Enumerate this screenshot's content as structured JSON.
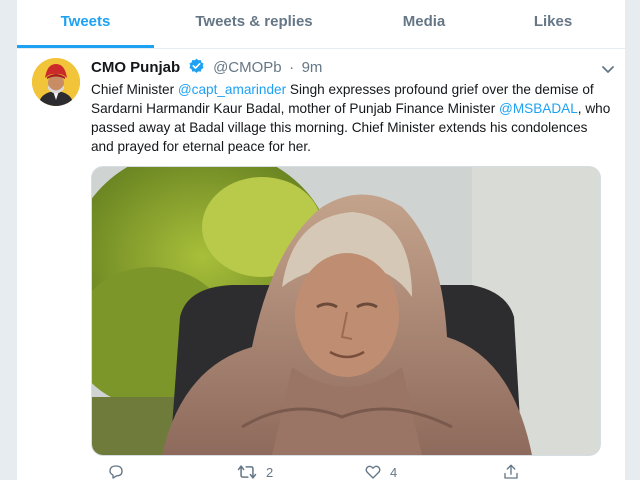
{
  "tabs": [
    {
      "label": "Tweets",
      "active": true
    },
    {
      "label": "Tweets & replies",
      "active": false
    },
    {
      "label": "Media",
      "active": false
    },
    {
      "label": "Likes",
      "active": false
    }
  ],
  "tweet": {
    "author_name": "CMO Punjab",
    "handle": "@CMOPb",
    "separator": "·",
    "time": "9m",
    "text_parts": {
      "p1": "Chief Minister ",
      "m1": "@capt_amarinder",
      "p2": " Singh expresses profound grief over the demise of Sardarni Harmandir Kaur Badal, mother of Punjab Finance Minister ",
      "m2": "@MSBADAL",
      "p3": ", who passed away at Badal village this morning. Chief Minister extends his condolences and prayed for eternal peace for her."
    },
    "actions": {
      "reply_count": "",
      "retweet_count": "2",
      "like_count": "4"
    }
  },
  "icons": {
    "verified": "verified-badge-icon",
    "caret": "chevron-down-icon",
    "reply": "reply-icon",
    "retweet": "retweet-icon",
    "like": "heart-icon",
    "share": "share-icon"
  },
  "colors": {
    "accent": "#1da1f2",
    "text": "#14171a",
    "muted": "#657786",
    "border": "#e6ecf0"
  }
}
